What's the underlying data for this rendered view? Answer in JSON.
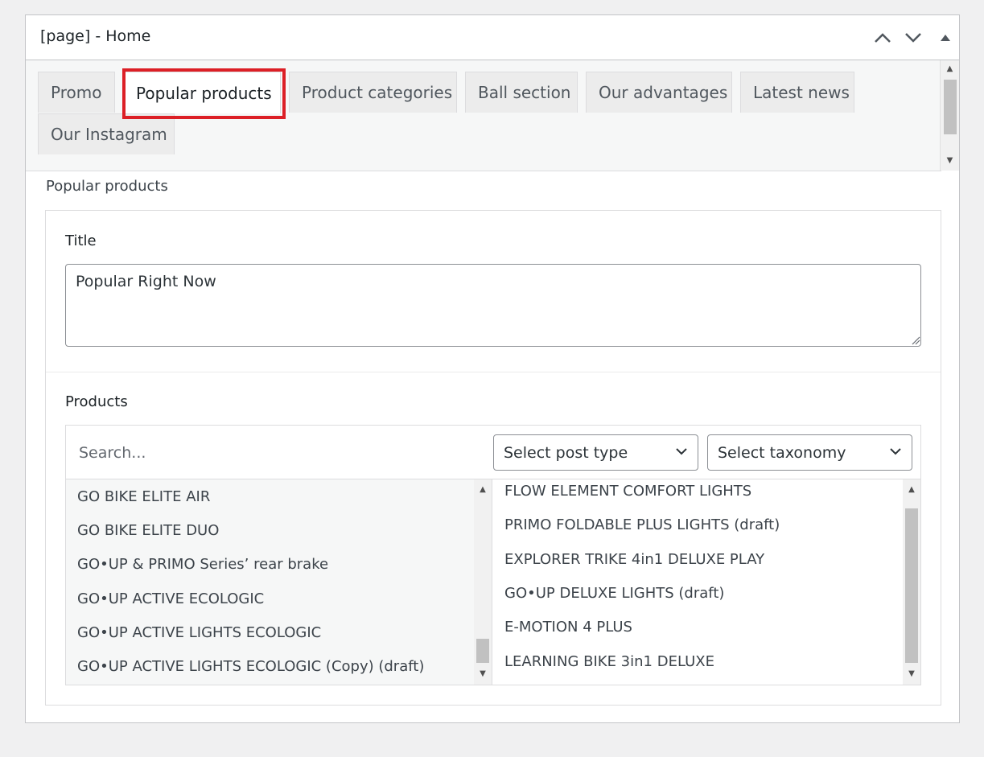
{
  "panel": {
    "title": "[page] - Home",
    "controls": [
      "chevron-up",
      "chevron-down",
      "triangle-up"
    ]
  },
  "tabs": [
    {
      "label": "Promo",
      "active": false
    },
    {
      "label": "Popular products",
      "active": true
    },
    {
      "label": "Product categories",
      "active": false
    },
    {
      "label": "Ball section",
      "active": false
    },
    {
      "label": "Our advantages",
      "active": false
    },
    {
      "label": "Latest news",
      "active": false
    },
    {
      "label": "Our Instagram",
      "active": false
    }
  ],
  "section": {
    "label": "Popular products",
    "title_field": {
      "label": "Title",
      "value": "Popular Right Now"
    },
    "products_field": {
      "label": "Products",
      "search_placeholder": "Search...",
      "post_type_select": "Select post type",
      "taxonomy_select": "Select taxonomy",
      "available": [
        "GO BIKE ELITE AIR",
        "GO BIKE ELITE DUO",
        "GO•UP & PRIMO Series’ rear brake",
        "GO•UP ACTIVE ECOLOGIC",
        "GO•UP ACTIVE LIGHTS ECOLOGIC",
        "GO•UP ACTIVE LIGHTS ECOLOGIC (Copy) (draft)"
      ],
      "selected": [
        "FLOW ELEMENT COMFORT LIGHTS",
        "PRIMO FOLDABLE PLUS LIGHTS (draft)",
        "EXPLORER TRIKE 4in1 DELUXE PLAY",
        "GO•UP DELUXE LIGHTS (draft)",
        "E-MOTION 4 PLUS",
        "LEARNING BIKE 3in1 DELUXE"
      ]
    }
  },
  "colors": {
    "highlight": "#dc1f26",
    "background": "#f0f0f1",
    "panel": "#ffffff",
    "tab": "#ececec"
  }
}
